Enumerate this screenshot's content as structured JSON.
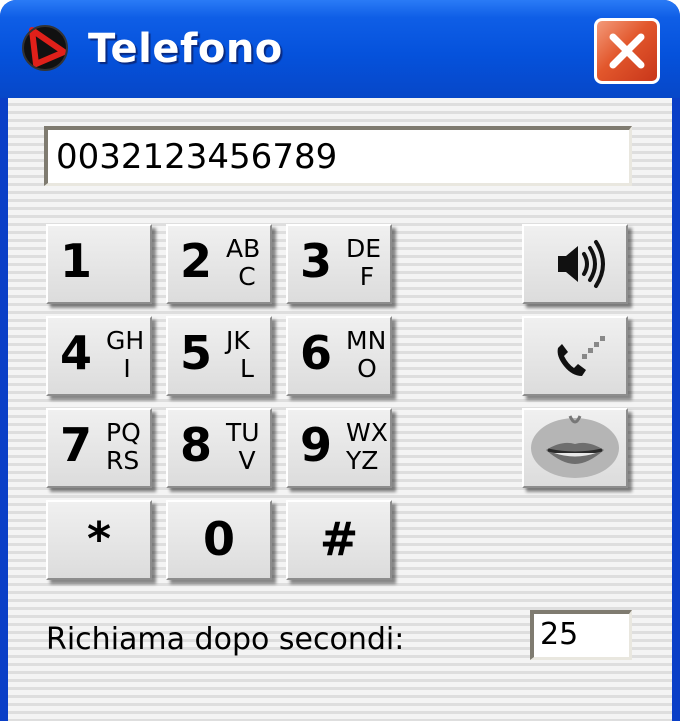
{
  "window": {
    "title": "Telefono",
    "app_icon": "app-logo-icon",
    "close_icon": "close-icon",
    "titlebar_color": "#0552dc",
    "close_color": "#e2572c"
  },
  "dialer": {
    "number": "0032123456789",
    "keys": [
      {
        "digit": "1",
        "top": "",
        "bottom": ""
      },
      {
        "digit": "2",
        "top": "AB",
        "bottom": "C"
      },
      {
        "digit": "3",
        "top": "DE",
        "bottom": "F"
      },
      {
        "digit": "4",
        "top": "GH",
        "bottom": "I"
      },
      {
        "digit": "5",
        "top": "JK",
        "bottom": "L"
      },
      {
        "digit": "6",
        "top": "MN",
        "bottom": "O"
      },
      {
        "digit": "7",
        "top": "PQ",
        "bottom": "RS"
      },
      {
        "digit": "8",
        "top": "TU",
        "bottom": "V"
      },
      {
        "digit": "9",
        "top": "WX",
        "bottom": "YZ"
      },
      {
        "digit": "*",
        "top": "",
        "bottom": ""
      },
      {
        "digit": "0",
        "top": "",
        "bottom": ""
      },
      {
        "digit": "#",
        "top": "",
        "bottom": ""
      }
    ]
  },
  "side_buttons": [
    {
      "icon": "speaker-icon"
    },
    {
      "icon": "phone-call-icon"
    },
    {
      "icon": "mouth-icon"
    }
  ],
  "footer": {
    "redial_label": "Richiama dopo secondi:",
    "redial_seconds": "25"
  }
}
